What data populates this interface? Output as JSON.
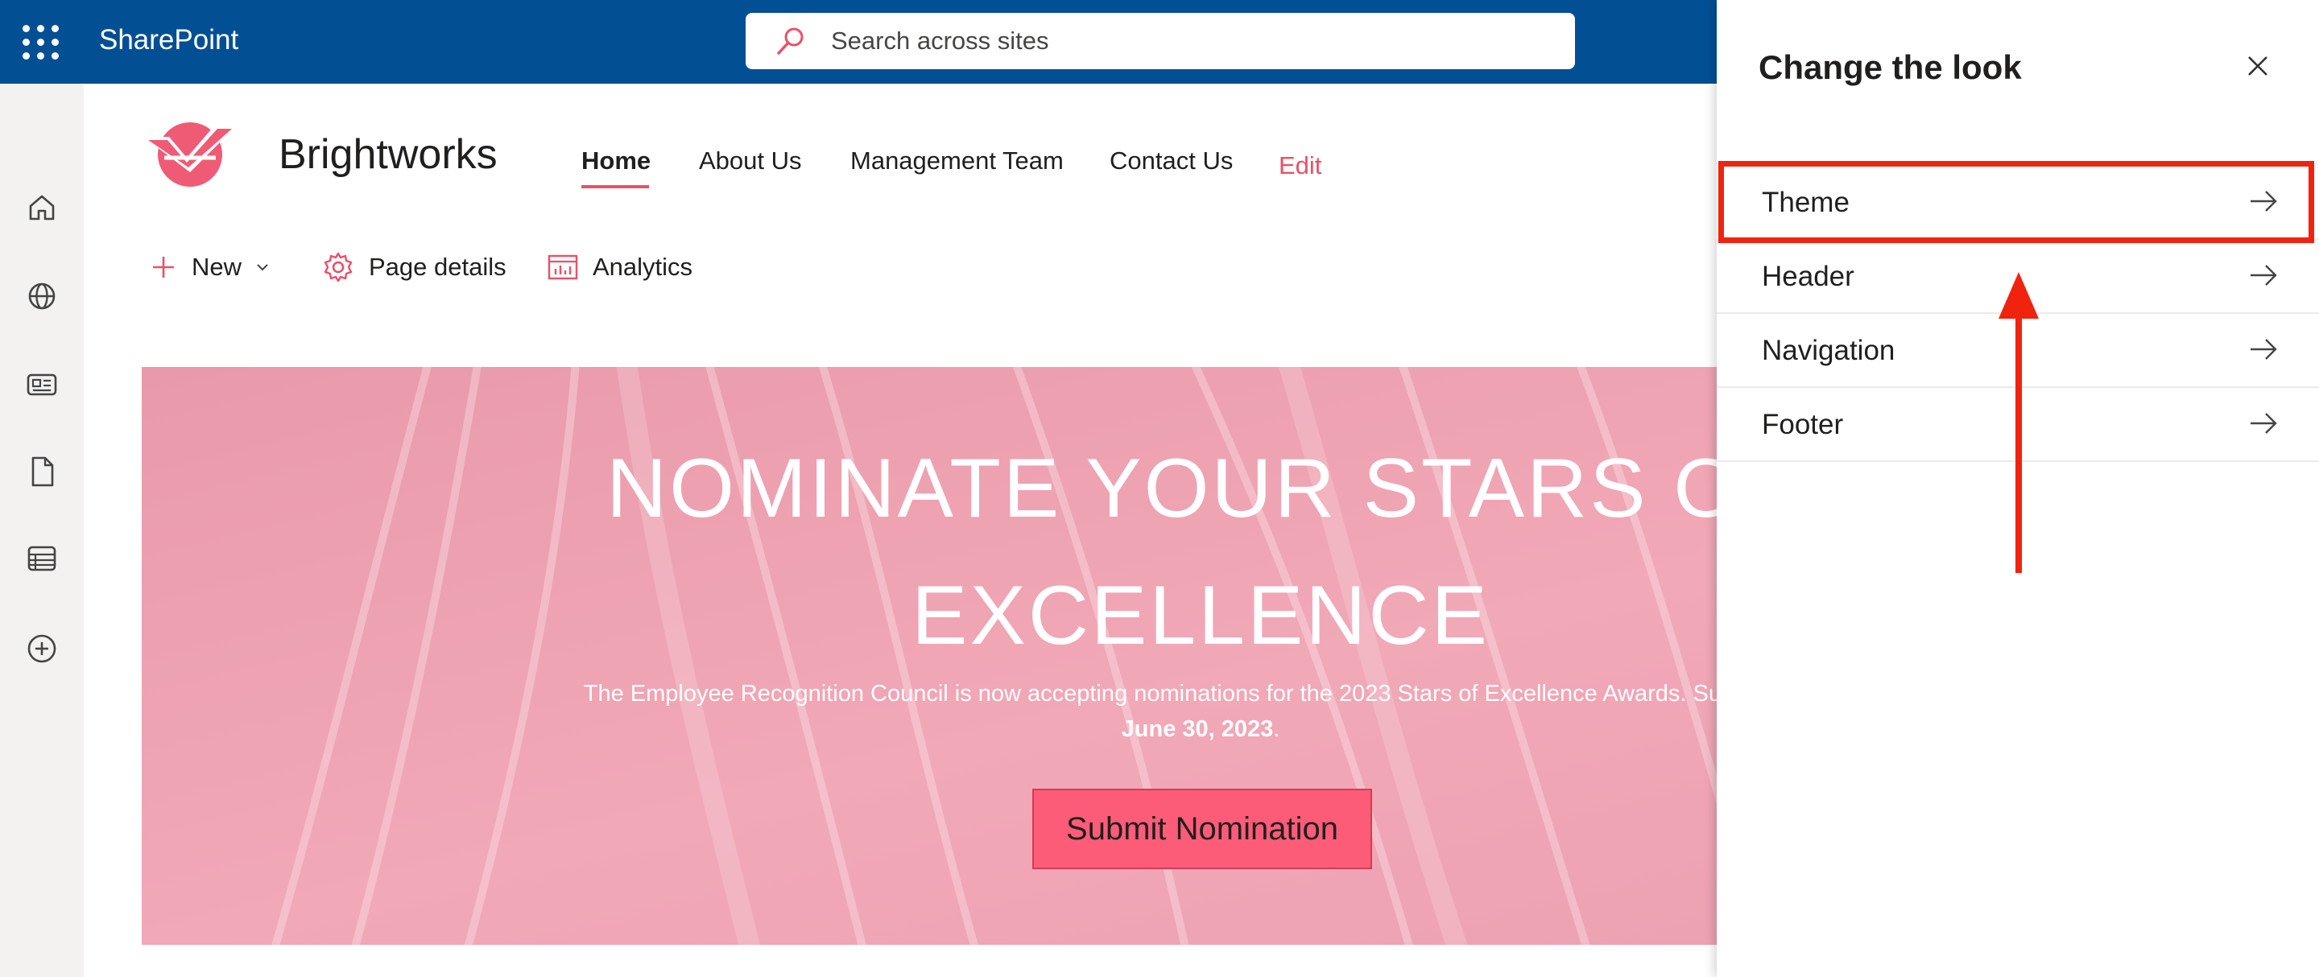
{
  "suitebar": {
    "app_name": "SharePoint",
    "search_placeholder": "Search across sites"
  },
  "appbar": {
    "icons": [
      "home-icon",
      "globe-icon",
      "news-icon",
      "file-icon",
      "list-icon",
      "add-circle-icon"
    ]
  },
  "site": {
    "title": "Brightworks",
    "nav": {
      "home": "Home",
      "about": "About Us",
      "management": "Management Team",
      "contact": "Contact Us",
      "edit": "Edit"
    },
    "commands": {
      "new": "New",
      "page_details": "Page details",
      "analytics": "Analytics"
    }
  },
  "hero": {
    "title_line1": "NOMINATE YOUR STARS OF",
    "title_line2": "EXCELLENCE",
    "description": "The Employee Recognition Council is now accepting nominations for the 2023 Stars of Excellence Awards. Submit your",
    "date": "June 30, 2023",
    "date_suffix": ".",
    "button": "Submit Nomination"
  },
  "panel": {
    "title": "Change the look",
    "items": [
      {
        "label": "Theme"
      },
      {
        "label": "Header"
      },
      {
        "label": "Navigation"
      },
      {
        "label": "Footer"
      }
    ]
  },
  "colors": {
    "suitebar": "#034f94",
    "accent": "#e9506a",
    "hero_bg": "#eea2b3",
    "button": "#fc5c78",
    "annotation": "#f0230f"
  }
}
